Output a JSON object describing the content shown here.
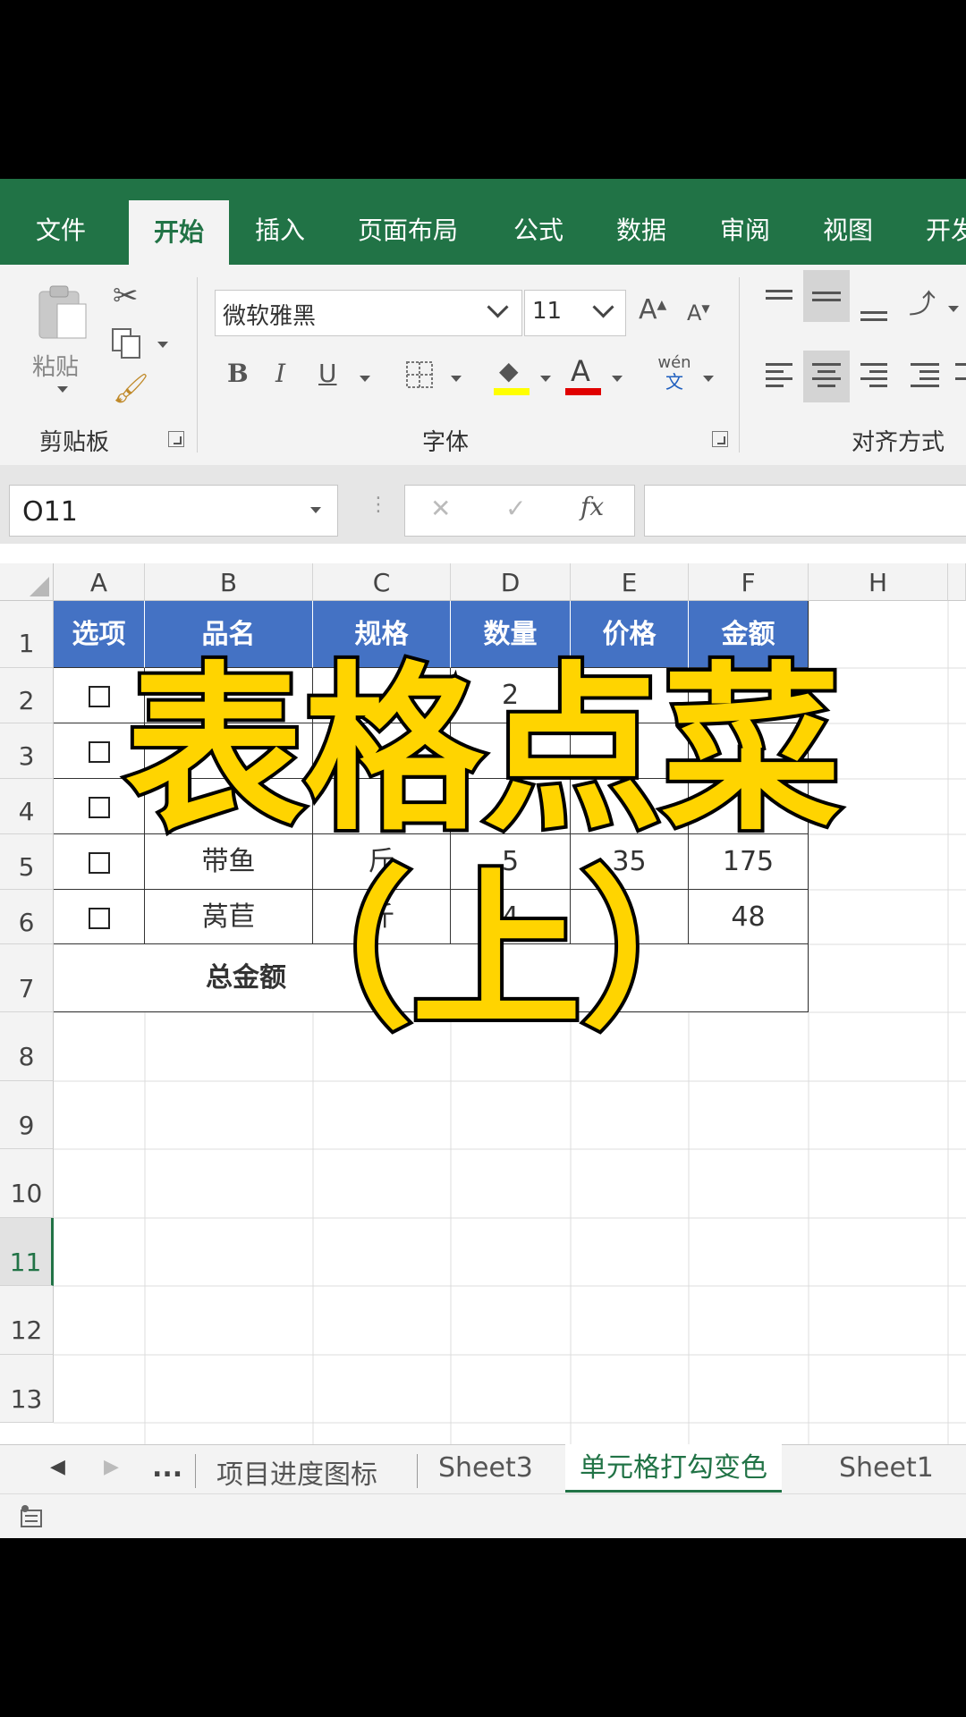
{
  "ribbon": {
    "tabs": [
      "文件",
      "开始",
      "插入",
      "页面布局",
      "公式",
      "数据",
      "审阅",
      "视图",
      "开发"
    ],
    "active_tab": "开始",
    "groups": [
      "剪贴板",
      "字体",
      "对齐方式"
    ],
    "paste_label": "粘贴",
    "font_name": "微软雅黑",
    "font_size": "11",
    "phonetic_top": "wén",
    "phonetic_bottom": "文"
  },
  "formula_bar": {
    "name_box": "O11",
    "fx": "fx",
    "value": ""
  },
  "grid": {
    "columns": [
      "A",
      "B",
      "C",
      "D",
      "E",
      "F",
      "H"
    ],
    "rows": [
      "1",
      "2",
      "3",
      "4",
      "5",
      "6",
      "7",
      "8",
      "9",
      "10",
      "11",
      "12",
      "13"
    ],
    "selected_row": "11",
    "header": [
      "选项",
      "品名",
      "规格",
      "数量",
      "价格",
      "金额"
    ],
    "data_rows": [
      {
        "name": "",
        "unit": "",
        "qty": "2",
        "price": "",
        "amount": ""
      },
      {
        "name": "",
        "unit": "",
        "qty": "",
        "price": "",
        "amount": ""
      },
      {
        "name": "",
        "unit": "",
        "qty": "",
        "price": "",
        "amount": ""
      },
      {
        "name": "带鱼",
        "unit": "斤",
        "qty": "5",
        "price": "35",
        "amount": "175"
      },
      {
        "name": "莴苣",
        "unit": "斤",
        "qty": "4",
        "price": "",
        "amount": "48"
      }
    ],
    "total_label": "总金额"
  },
  "overlay": {
    "title": "表格点菜",
    "subtitle": "（上）",
    "color": "#ffd400"
  },
  "sheets": {
    "nav_more": "...",
    "tabs": [
      "项目进度图标",
      "Sheet3",
      "单元格打勾变色",
      "Sheet1"
    ],
    "active": "单元格打勾变色"
  },
  "colors": {
    "excel_green": "#217346",
    "header_blue": "#4472c4"
  }
}
